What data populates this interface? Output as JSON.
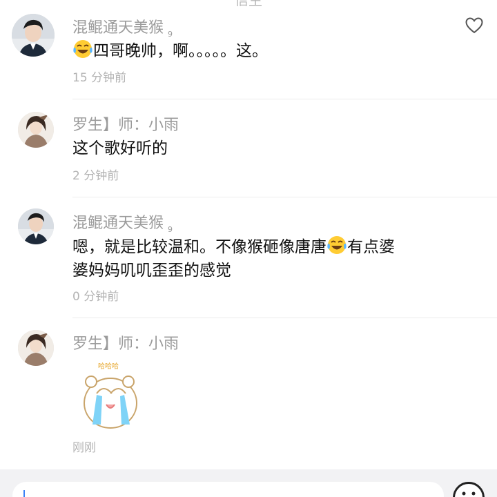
{
  "header": {
    "title_partial": "信生"
  },
  "comments": [
    {
      "username": "混鲲通天美猴",
      "level": "9",
      "text": "四哥晚帅，啊。。。。。这。",
      "time": "15 分钟前"
    },
    {
      "username": "罗生】师：小雨",
      "level": "",
      "text": "这个歌好听的",
      "time": "2 分钟前"
    },
    {
      "username": "混鲲通天美猴",
      "level": "9",
      "text_line1_a": "嗯，就是比较温和。不像猴砸像唐唐",
      "text_line1_b": "有点婆",
      "text_line2": "婆妈妈叽叽歪歪的感觉",
      "time": "0 分钟前"
    },
    {
      "username": "罗生】师：小雨",
      "level": "",
      "sticker_caption": "哈哈哈",
      "time": "刚刚"
    }
  ],
  "icons": {
    "like": "heart-outline-icon",
    "emoji": "laughing-tears-emoji",
    "input_emoji": "smiley-face-icon"
  },
  "colors": {
    "username": "#9b9b9b",
    "text": "#111111",
    "time": "#b3b3b3",
    "divider": "#ececec",
    "input_bar": "#f2f2f4",
    "cursor": "#3b82f6"
  }
}
